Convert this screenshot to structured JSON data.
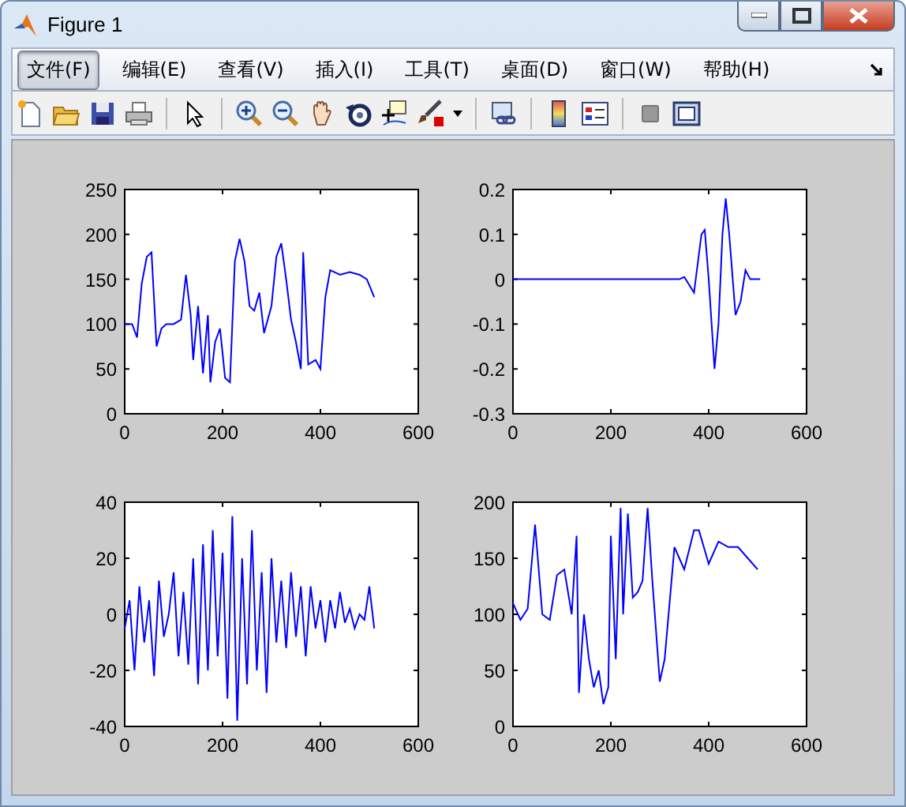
{
  "window": {
    "title": "Figure 1"
  },
  "menu": [
    {
      "label": "文件(F)",
      "selected": true
    },
    {
      "label": "编辑(E)",
      "selected": false
    },
    {
      "label": "查看(V)",
      "selected": false
    },
    {
      "label": "插入(I)",
      "selected": false
    },
    {
      "label": "工具(T)",
      "selected": false
    },
    {
      "label": "桌面(D)",
      "selected": false
    },
    {
      "label": "窗口(W)",
      "selected": false
    },
    {
      "label": "帮助(H)",
      "selected": false
    }
  ],
  "plots": [
    {
      "chart_data": {
        "type": "line",
        "xlim": [
          0,
          600
        ],
        "ylim": [
          0,
          250
        ],
        "xticks": [
          0,
          200,
          400,
          600
        ],
        "yticks": [
          0,
          50,
          100,
          150,
          200,
          250
        ],
        "x": [
          0,
          15,
          25,
          35,
          45,
          55,
          65,
          75,
          85,
          100,
          115,
          125,
          135,
          140,
          150,
          160,
          170,
          175,
          185,
          195,
          205,
          215,
          225,
          235,
          245,
          255,
          265,
          275,
          285,
          300,
          310,
          320,
          330,
          340,
          350,
          360,
          365,
          375,
          390,
          400,
          410,
          420,
          440,
          460,
          480,
          495,
          510
        ],
        "series": [
          {
            "color": "#0000ff",
            "values": [
              100,
              100,
              85,
              145,
              175,
              180,
              75,
              95,
              100,
              100,
              105,
              155,
              110,
              60,
              120,
              45,
              110,
              35,
              80,
              95,
              40,
              35,
              170,
              195,
              170,
              120,
              115,
              135,
              90,
              120,
              175,
              190,
              150,
              105,
              80,
              50,
              180,
              55,
              60,
              50,
              130,
              160,
              155,
              158,
              155,
              150,
              130
            ]
          }
        ]
      }
    },
    {
      "chart_data": {
        "type": "line",
        "xlim": [
          0,
          600
        ],
        "ylim": [
          -0.3,
          0.2
        ],
        "xticks": [
          0,
          200,
          400,
          600
        ],
        "yticks": [
          -0.3,
          -0.2,
          -0.1,
          0,
          0.1,
          0.2
        ],
        "x": [
          0,
          340,
          350,
          370,
          385,
          392,
          400,
          412,
          420,
          428,
          435,
          442,
          455,
          465,
          475,
          485,
          505
        ],
        "series": [
          {
            "color": "#0000ff",
            "values": [
              0,
              0,
              0.005,
              -0.03,
              0.1,
              0.11,
              0,
              -0.2,
              -0.1,
              0.1,
              0.18,
              0.1,
              -0.08,
              -0.05,
              0.02,
              0,
              0
            ]
          }
        ]
      }
    },
    {
      "chart_data": {
        "type": "line",
        "xlim": [
          0,
          600
        ],
        "ylim": [
          -40,
          40
        ],
        "xticks": [
          0,
          200,
          400,
          600
        ],
        "yticks": [
          -40,
          -20,
          0,
          20,
          40
        ],
        "x": [
          0,
          10,
          20,
          30,
          40,
          50,
          60,
          70,
          80,
          90,
          100,
          110,
          120,
          130,
          140,
          150,
          160,
          170,
          180,
          190,
          200,
          210,
          220,
          230,
          240,
          250,
          260,
          270,
          280,
          290,
          300,
          310,
          320,
          330,
          340,
          350,
          360,
          370,
          380,
          390,
          400,
          410,
          420,
          430,
          440,
          450,
          460,
          470,
          480,
          490,
          500,
          510
        ],
        "series": [
          {
            "color": "#0000ff",
            "values": [
              -5,
              5,
              -20,
              10,
              -10,
              5,
              -22,
              12,
              -8,
              0,
              15,
              -15,
              8,
              -18,
              20,
              -25,
              25,
              -20,
              30,
              -15,
              22,
              -30,
              35,
              -38,
              20,
              -25,
              30,
              -20,
              15,
              -28,
              20,
              -10,
              12,
              -12,
              15,
              -8,
              10,
              -15,
              10,
              -5,
              5,
              -10,
              5,
              -5,
              8,
              -3,
              2,
              -5,
              0,
              -2,
              10,
              -5
            ]
          }
        ]
      }
    },
    {
      "chart_data": {
        "type": "line",
        "xlim": [
          0,
          600
        ],
        "ylim": [
          0,
          200
        ],
        "xticks": [
          0,
          200,
          400,
          600
        ],
        "yticks": [
          0,
          50,
          100,
          150,
          200
        ],
        "x": [
          0,
          15,
          30,
          45,
          60,
          75,
          90,
          105,
          120,
          130,
          135,
          145,
          155,
          165,
          175,
          185,
          195,
          200,
          210,
          220,
          225,
          235,
          245,
          255,
          265,
          275,
          285,
          300,
          310,
          320,
          330,
          340,
          350,
          370,
          380,
          390,
          400,
          420,
          440,
          460,
          480,
          500
        ],
        "series": [
          {
            "color": "#0000ff",
            "values": [
              110,
              95,
              105,
              180,
              100,
              95,
              135,
              140,
              100,
              170,
              30,
              100,
              60,
              35,
              50,
              20,
              35,
              170,
              60,
              195,
              100,
              190,
              115,
              120,
              130,
              195,
              130,
              40,
              60,
              110,
              160,
              150,
              140,
              175,
              175,
              160,
              145,
              165,
              160,
              160,
              150,
              140
            ]
          }
        ]
      }
    }
  ]
}
